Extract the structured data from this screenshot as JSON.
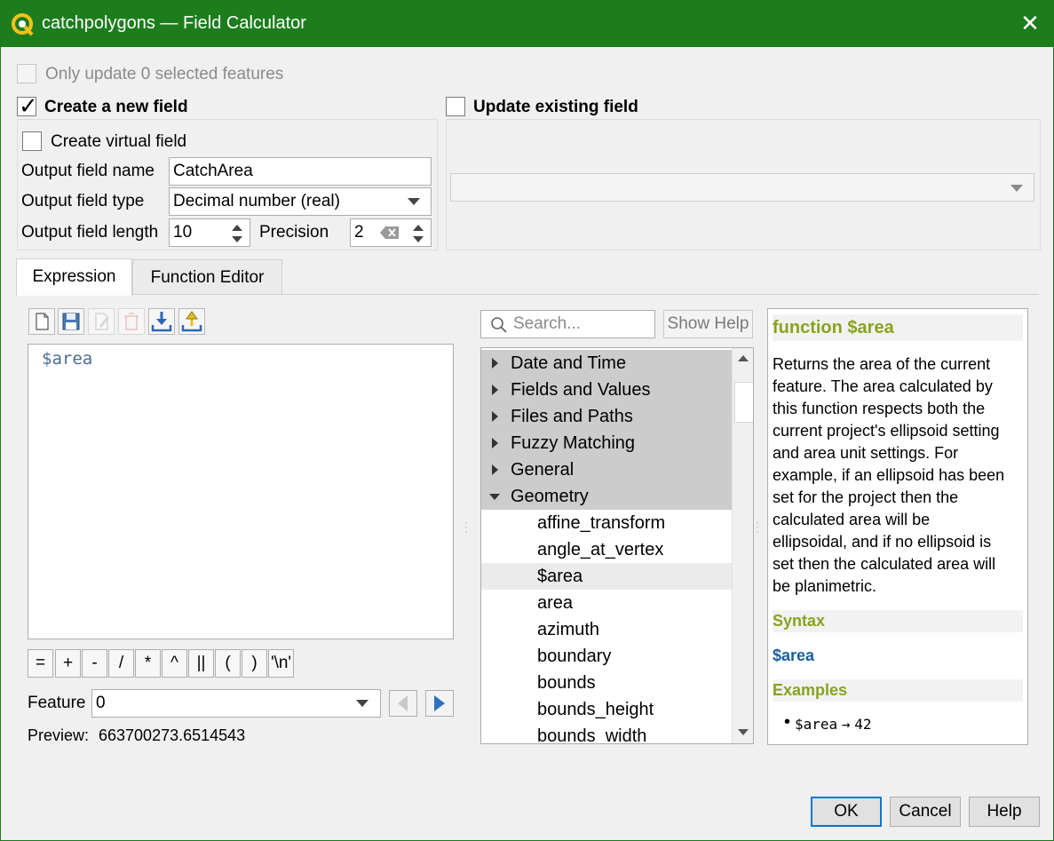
{
  "window": {
    "title": "catchpolygons — Field Calculator",
    "close_glyph": "✕"
  },
  "top": {
    "only_update_label": "Only update 0 selected features",
    "only_update_checked": false
  },
  "create_field": {
    "label": "Create a new field",
    "checked": true,
    "virtual_label": "Create virtual field",
    "virtual_checked": false,
    "name_label": "Output field name",
    "name_value": "CatchArea",
    "type_label": "Output field type",
    "type_value": "Decimal number (real)",
    "length_label": "Output field length",
    "length_value": "10",
    "precision_label": "Precision",
    "precision_value": "2"
  },
  "update_field": {
    "label": "Update existing field",
    "checked": false,
    "combo_value": ""
  },
  "tabs": [
    {
      "label": "Expression",
      "active": true
    },
    {
      "label": "Function Editor",
      "active": false
    }
  ],
  "toolbar": {
    "icons": [
      "new-file-icon",
      "save-icon",
      "edit-icon",
      "delete-icon",
      "import-icon",
      "export-icon"
    ]
  },
  "expression": {
    "text": "$area"
  },
  "operators": [
    "=",
    "+",
    "-",
    "/",
    "*",
    "^",
    "||",
    "(",
    ")",
    "'\\n'"
  ],
  "feature": {
    "label": "Feature",
    "value": "0"
  },
  "preview": {
    "label": "Preview:",
    "value": "663700273.6514543"
  },
  "search": {
    "placeholder": "Search...",
    "show_help_label": "Show Help"
  },
  "tree": {
    "groups": [
      {
        "label": "Date and Time",
        "expanded": false
      },
      {
        "label": "Fields and Values",
        "expanded": false
      },
      {
        "label": "Files and Paths",
        "expanded": false
      },
      {
        "label": "Fuzzy Matching",
        "expanded": false
      },
      {
        "label": "General",
        "expanded": false
      },
      {
        "label": "Geometry",
        "expanded": true
      }
    ],
    "functions": [
      "affine_transform",
      "angle_at_vertex",
      "$area",
      "area",
      "azimuth",
      "boundary",
      "bounds",
      "bounds_height",
      "bounds_width"
    ],
    "selected_function": "$area"
  },
  "help": {
    "title": "function $area",
    "description": [
      "Returns the area of the current",
      "feature. The area calculated by",
      "this function respects both the",
      "current project's ellipsoid setting",
      "and area unit settings. For",
      "example, if an ellipsoid has been",
      "set for the project then the",
      "calculated area will be",
      "ellipsoidal, and if no ellipsoid is",
      "set then the calculated area will",
      "be planimetric."
    ],
    "syntax_heading": "Syntax",
    "syntax": "$area",
    "examples_heading": "Examples",
    "example_code": "$area",
    "example_arrow": "→",
    "example_result": "42"
  },
  "buttons": {
    "ok": "OK",
    "cancel": "Cancel",
    "help": "Help"
  },
  "colors": {
    "titlebar": "#1d7d1d",
    "help_heading": "#88a320",
    "syntax": "#1a5fa0",
    "group_bg": "#cccccc"
  }
}
